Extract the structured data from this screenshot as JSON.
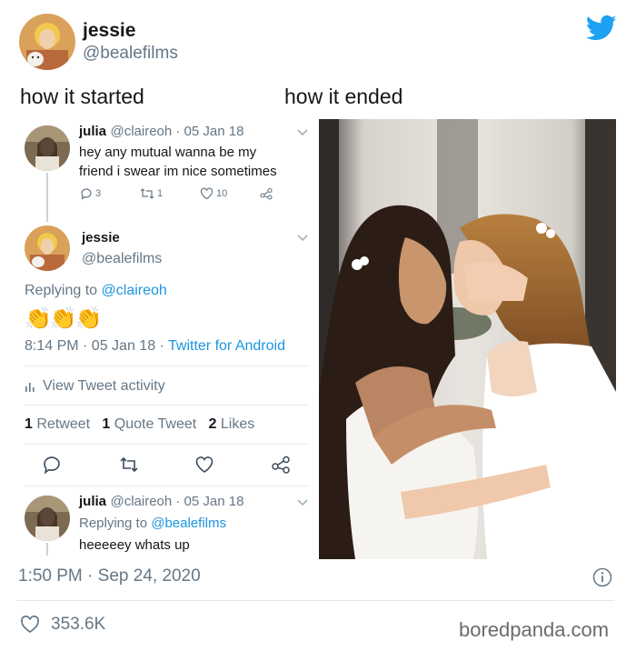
{
  "outer": {
    "name": "jessie",
    "handle": "@bealefilms",
    "caption_left": "how it started",
    "caption_right": "how it ended",
    "timestamp": "1:50 PM · Sep 24, 2020",
    "likes": "353.6K",
    "watermark": "boredpanda.com"
  },
  "tweet1": {
    "name": "julia",
    "meta": "@claireoh · 05 Jan 18",
    "text_line1": "hey any mutual wanna be my",
    "text_line2": "friend i swear im nice sometimes",
    "replies": "3",
    "retweets": "1",
    "likes": "10"
  },
  "tweet2": {
    "name": "jessie",
    "handle": "@bealefilms",
    "replying_prefix": "Replying to ",
    "replying_to": "@claireoh",
    "emoji": "👏👏👏",
    "time": "8:14 PM · 05 Jan 18 · ",
    "client": "Twitter for Android",
    "activity": "View Tweet activity",
    "retweets_num": "1",
    "retweets_label": "Retweet",
    "quotes_num": "1",
    "quotes_label": "Quote Tweet",
    "likes_num": "2",
    "likes_label": "Likes"
  },
  "tweet3": {
    "name": "julia",
    "meta": "@claireoh · 05 Jan 18",
    "replying_prefix": "Replying to ",
    "replying_to": "@bealefilms",
    "text": "heeeeey whats up"
  },
  "icons": {
    "brand": "twitter-bird-icon",
    "reply": "reply-icon",
    "retweet": "retweet-icon",
    "like": "heart-icon",
    "share": "share-icon",
    "info": "info-icon"
  },
  "colors": {
    "brand_blue": "#1da1f2",
    "link_blue": "#1b95e0",
    "secondary_text": "#657786"
  }
}
